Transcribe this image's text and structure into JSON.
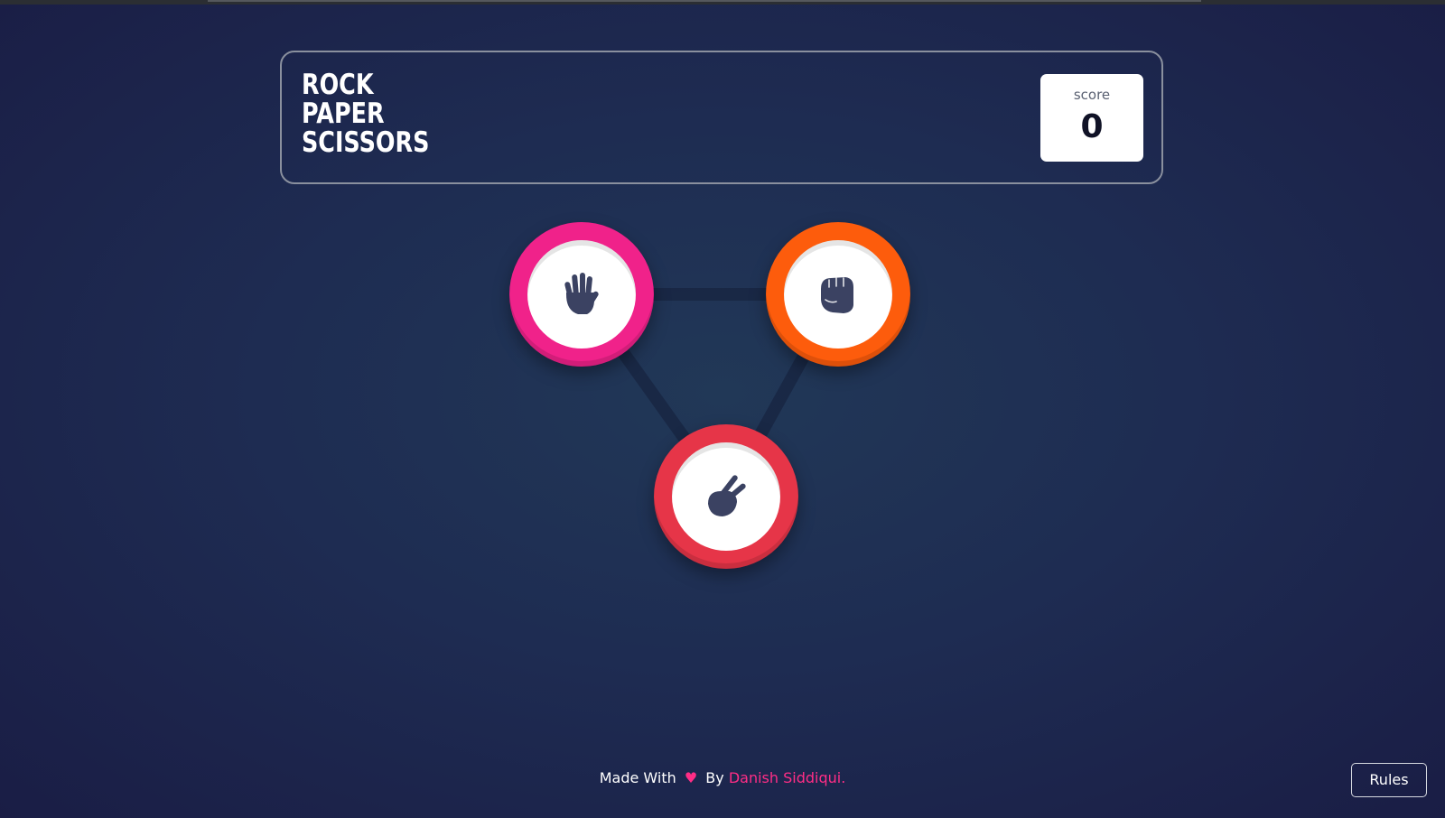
{
  "header": {
    "title_lines": [
      "ROCK",
      "PAPER",
      "SCISSORS"
    ],
    "score_label": "score",
    "score_value": "0"
  },
  "choices": [
    {
      "name": "paper",
      "ring_color": "#f0228a",
      "icon": "paper-hand-icon"
    },
    {
      "name": "rock",
      "ring_color": "#fd5c0c",
      "icon": "rock-fist-icon"
    },
    {
      "name": "scissors",
      "ring_color": "#e63548",
      "icon": "scissors-hand-icon"
    }
  ],
  "footer": {
    "made_with": "Made With",
    "heart_icon": "heart-icon",
    "by": "By",
    "author": "Danish Siddiqui."
  },
  "rules_button": "Rules",
  "colors": {
    "background": "#1e2c52",
    "icon": "#3b4262",
    "accent_pink": "#ff2d86"
  }
}
